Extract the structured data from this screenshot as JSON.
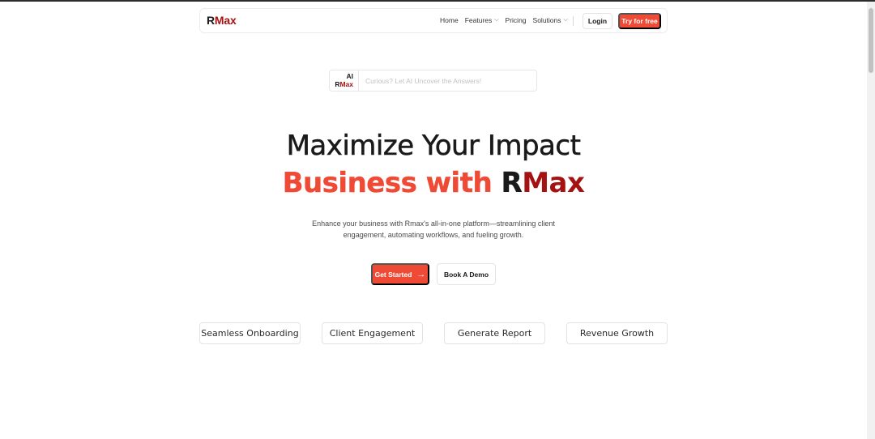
{
  "brand": {
    "logo_r": "R",
    "logo_max": "Max",
    "accent_color": "#ef4a35",
    "brand_red": "#a51212"
  },
  "nav": {
    "home": "Home",
    "features": "Features",
    "pricing": "Pricing",
    "solutions": "Solutions",
    "login": "Login",
    "try_free": "Try for free"
  },
  "ai_search": {
    "badge_ai": "AI",
    "badge_r": "R",
    "badge_max": "Max",
    "placeholder": "Curious? Let AI Uncover the Answers!"
  },
  "hero": {
    "title_line1": "Maximize Your Impact",
    "title_line2_orange": "Business with ",
    "title_line2_r": "R",
    "title_line2_max": "Max",
    "description": "Enhance your business with Rmax's all-in-one platform—streamlining client engagement, automating workflows, and fueling growth.",
    "cta_primary": "Get Started",
    "cta_secondary": "Book A Demo"
  },
  "features": [
    {
      "label": "Seamless Onboarding"
    },
    {
      "label": "Client Engagement"
    },
    {
      "label": "Generate Report"
    },
    {
      "label": "Revenue Growth"
    }
  ]
}
